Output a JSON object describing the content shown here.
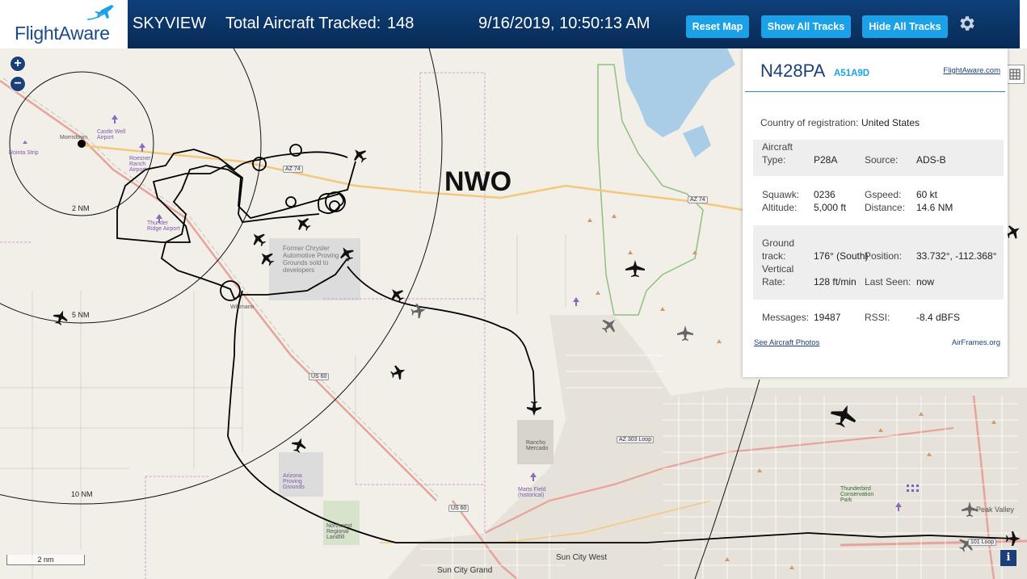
{
  "header": {
    "logo": "FlightAware",
    "app_title": "SKYVIEW",
    "tracked_label": "Total Aircraft Tracked:",
    "tracked_count": "148",
    "datetime": "9/16/2019, 10:50:13 AM",
    "buttons": {
      "reset": "Reset Map",
      "show_tracks": "Show All Tracks",
      "hide_tracks": "Hide All Tracks"
    },
    "settings_icon": "gear-icon"
  },
  "map": {
    "zoom_in": "+",
    "zoom_out": "−",
    "center_label": "NWO",
    "range_rings": [
      "2 NM",
      "5 NM",
      "10 NM"
    ],
    "scale": "2 nm",
    "info_label": "i",
    "labels": {
      "morristown": "Morristown",
      "castle_well": "Castle Well Airport",
      "rointa": "Rointa Strip",
      "roesner": "Roesner Ranch Airport",
      "thunder_ridge": "Thunder Ridge Airport",
      "former_chrysler": "Former Chrysler Automotive Proving Grounds sold to developers",
      "wittmann": "Wittmann",
      "arizona_proving": "Arizona Proving Grounds",
      "northwest_landfill": "Northwest Regional Landfill",
      "rancho_mercado": "Rancho Mercado",
      "marts_field": "Marts Field (historical)",
      "thunderbird": "Thunderbird Conservation Park",
      "sun_city_west": "Sun City West",
      "sun_city_grand": "Sun City Grand",
      "peak_valley": "Peak Valley",
      "az74a": "AZ 74",
      "az74b": "AZ 74",
      "us60a": "US 60",
      "us60b": "US 60",
      "az303": "AZ 303 Loop",
      "loop101": "101 Loop"
    }
  },
  "popup": {
    "registration": "N428PA",
    "hex": "A51A9D",
    "flightaware_link": "FlightAware.com",
    "country_label": "Country of registration:",
    "country_value": "United States",
    "aircraft_type_label": "Aircraft Type:",
    "aircraft_type_label_l1": "Aircraft",
    "aircraft_type_label_l2": "Type:",
    "aircraft_type_value": "P28A",
    "source_label": "Source:",
    "source_value": "ADS-B",
    "squawk_label": "Squawk:",
    "squawk_value": "0236",
    "gspeed_label": "Gspeed:",
    "gspeed_value": "60 kt",
    "altitude_label": "Altitude:",
    "altitude_value": "5,000 ft",
    "distance_label": "Distance:",
    "distance_value": "14.6 NM",
    "ground_track_label_l1": "Ground",
    "ground_track_label_l2": "track:",
    "ground_track_value": "176° (South)",
    "position_label": "Position:",
    "position_value": "33.732°, -112.368°",
    "vertical_rate_label_l1": "Vertical",
    "vertical_rate_label_l2": "Rate:",
    "vertical_rate_value": "128 ft/min",
    "last_seen_label": "Last Seen:",
    "last_seen_value": "now",
    "messages_label": "Messages:",
    "messages_value": "19487",
    "rssi_label": "RSSI:",
    "rssi_value": "-8.4 dBFS",
    "see_photos": "See Aircraft Photos",
    "airframes": "AirFrames.org"
  }
}
